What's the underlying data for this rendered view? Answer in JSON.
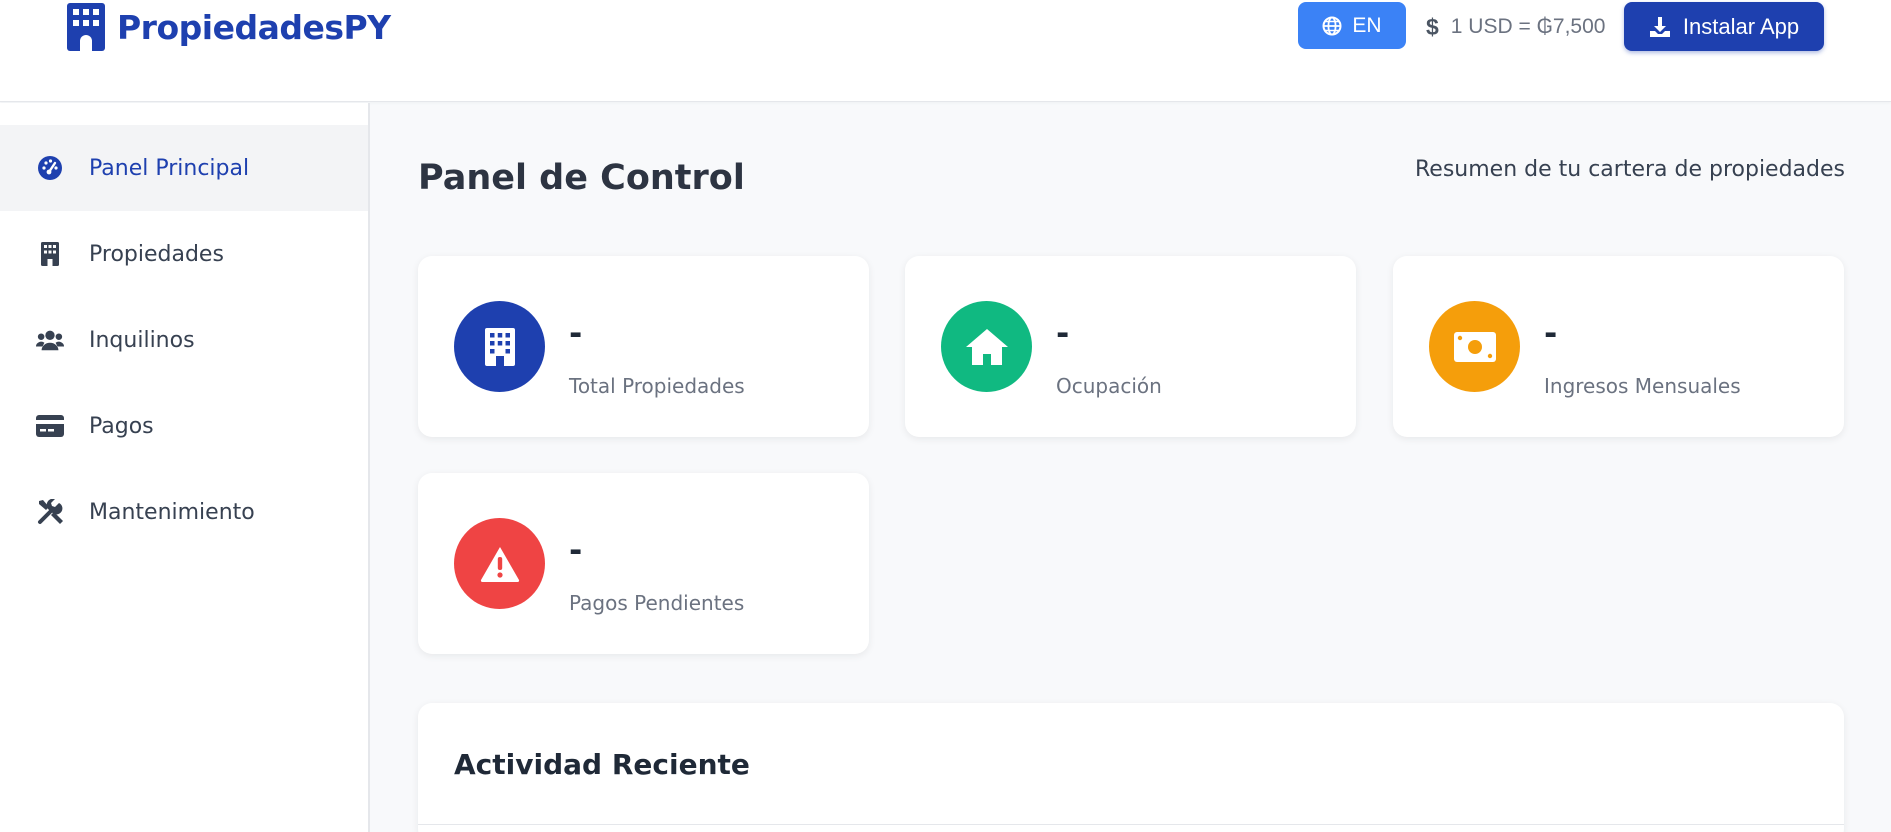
{
  "app": {
    "brand_name": "PropiedadesPY",
    "brand_icon": "building-icon",
    "brand_color": "#1e40af"
  },
  "header": {
    "language_button": {
      "label": "EN",
      "icon": "globe-icon",
      "color": "#3b82f6"
    },
    "exchange_rate": {
      "icon": "dollar-icon",
      "text": "1 USD = ₲7,500"
    },
    "install_button": {
      "label": "Instalar App",
      "icon": "download-icon",
      "color": "#1e40af"
    }
  },
  "sidebar": {
    "items": [
      {
        "label": "Panel Principal",
        "icon": "dashboard-gauge-icon",
        "active": true
      },
      {
        "label": "Propiedades",
        "icon": "building-icon",
        "active": false
      },
      {
        "label": "Inquilinos",
        "icon": "users-icon",
        "active": false
      },
      {
        "label": "Pagos",
        "icon": "credit-card-icon",
        "active": false
      },
      {
        "label": "Mantenimiento",
        "icon": "tools-icon",
        "active": false
      }
    ]
  },
  "main": {
    "title": "Panel de Control",
    "subtitle": "Resumen de tu cartera de propiedades",
    "stats": [
      {
        "value": "-",
        "label": "Total Propiedades",
        "icon": "building-icon",
        "color": "#1e40af"
      },
      {
        "value": "-",
        "label": "Ocupación",
        "icon": "home-icon",
        "color": "#10b981"
      },
      {
        "value": "-",
        "label": "Ingresos Mensuales",
        "icon": "money-bill-icon",
        "color": "#f59e0b"
      },
      {
        "value": "-",
        "label": "Pagos Pendientes",
        "icon": "warning-icon",
        "color": "#ef4444"
      }
    ],
    "activity": {
      "title": "Actividad Reciente"
    }
  }
}
